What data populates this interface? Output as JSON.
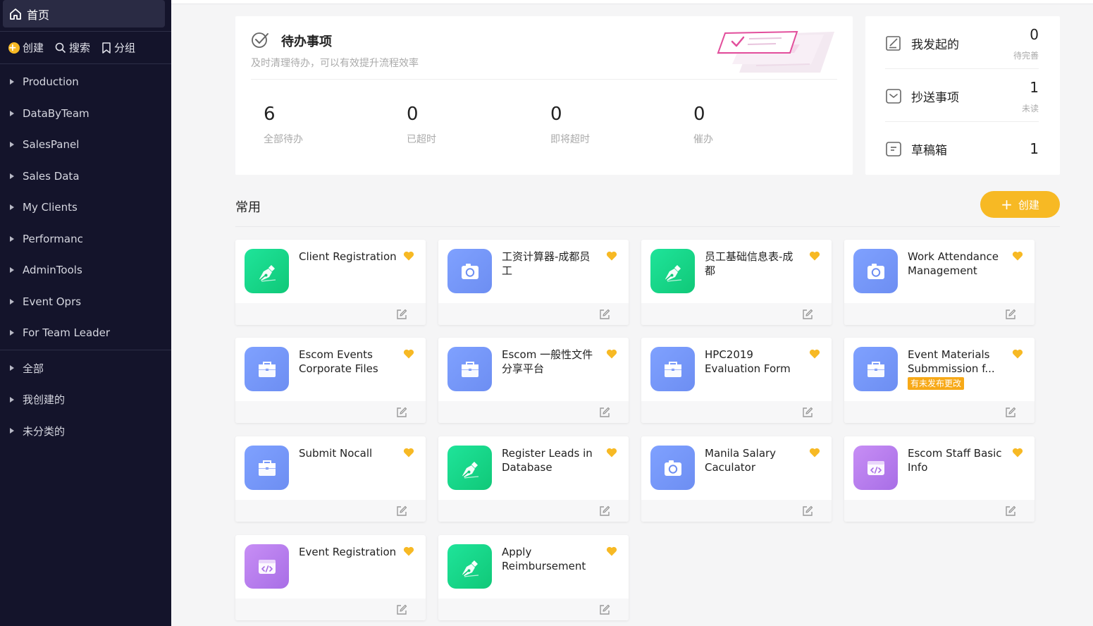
{
  "sidebar": {
    "home_label": "首页",
    "actions": {
      "create": "创建",
      "search": "搜索",
      "group": "分组"
    },
    "items": [
      {
        "label": "Production"
      },
      {
        "label": "DataByTeam"
      },
      {
        "label": "SalesPanel"
      },
      {
        "label": "Sales Data"
      },
      {
        "label": "My Clients"
      },
      {
        "label": "Performanc"
      },
      {
        "label": "AdminTools"
      },
      {
        "label": "Event Oprs"
      },
      {
        "label": "For Team Leader"
      }
    ],
    "filters": [
      {
        "label": "全部"
      },
      {
        "label": "我创建的"
      },
      {
        "label": "未分类的"
      }
    ]
  },
  "todo": {
    "title": "待办事项",
    "subtitle": "及时清理待办，可以有效提升流程效率",
    "stats": [
      {
        "value": "6",
        "label": "全部待办"
      },
      {
        "value": "0",
        "label": "已超时"
      },
      {
        "value": "0",
        "label": "即将超时"
      },
      {
        "value": "0",
        "label": "催办"
      }
    ]
  },
  "summary": {
    "initiated": {
      "label": "我发起的",
      "value": "0",
      "sub": "待完善"
    },
    "cc": {
      "label": "抄送事项",
      "value": "1",
      "sub": "未读"
    },
    "drafts": {
      "label": "草稿箱",
      "value": "1"
    }
  },
  "common": {
    "title": "常用",
    "create_label": "创建",
    "apps": [
      {
        "name": "Client Registration",
        "icon": "pen-icon",
        "color": "green"
      },
      {
        "name": "工资计算器-成都员工",
        "icon": "camera-icon",
        "color": "blue"
      },
      {
        "name": "员工基础信息表-成都",
        "icon": "pen-icon",
        "color": "green"
      },
      {
        "name": "Work Attendance Management",
        "icon": "camera-icon",
        "color": "blue"
      },
      {
        "name": "Escom Events Corporate Files",
        "icon": "briefcase-icon",
        "color": "blue"
      },
      {
        "name": "Escom 一般性文件分享平台",
        "icon": "briefcase-icon",
        "color": "blue"
      },
      {
        "name": "HPC2019 Evaluation Form",
        "icon": "briefcase-icon",
        "color": "blue"
      },
      {
        "name": "Event Materials Submmission f...",
        "icon": "briefcase-icon",
        "color": "blue",
        "badge": "有未发布更改"
      },
      {
        "name": "Submit Nocall",
        "icon": "briefcase-icon",
        "color": "blue"
      },
      {
        "name": "Register Leads in Database",
        "icon": "pen-icon",
        "color": "green"
      },
      {
        "name": "Manila Salary Caculator",
        "icon": "camera-icon",
        "color": "blue"
      },
      {
        "name": "Escom Staff Basic Info",
        "icon": "code-window-icon",
        "color": "purple"
      },
      {
        "name": "Event Registration",
        "icon": "code-window-icon",
        "color": "purple"
      },
      {
        "name": "Apply Reimbursement",
        "icon": "pen-icon",
        "color": "green"
      }
    ]
  },
  "colors": {
    "sidebar_bg": "#14142b",
    "accent": "#f7b924",
    "green_icon": "#10c878",
    "blue_icon": "#6d8ef2",
    "purple_icon": "#a86ee6"
  }
}
